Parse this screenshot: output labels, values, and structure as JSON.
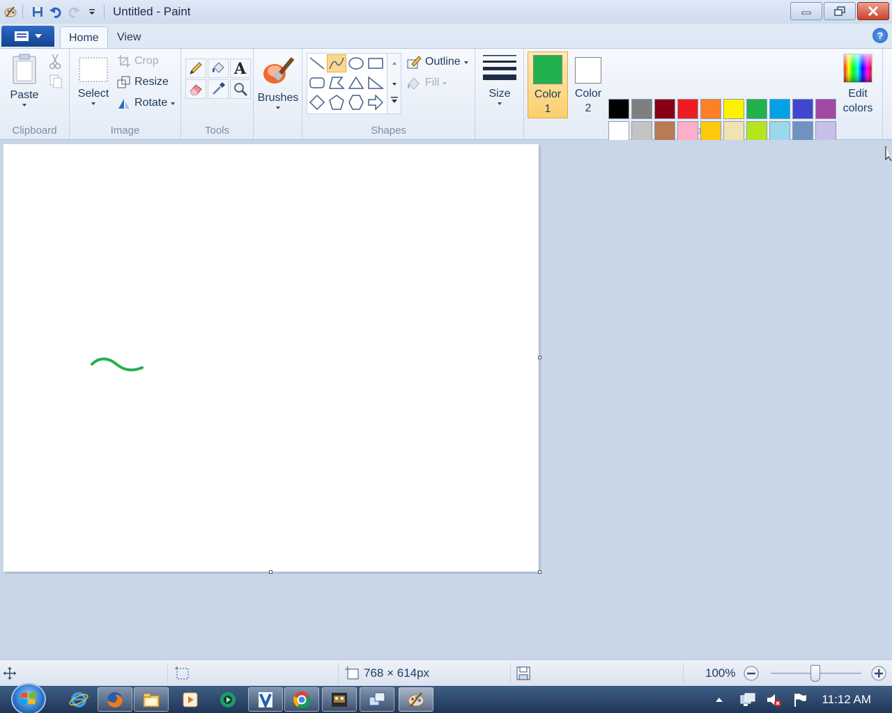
{
  "window": {
    "title": "Untitled - Paint"
  },
  "tabs": {
    "home": "Home",
    "view": "View"
  },
  "clipboard": {
    "paste": "Paste",
    "group": "Clipboard"
  },
  "image": {
    "select": "Select",
    "crop": "Crop",
    "resize": "Resize",
    "rotate": "Rotate",
    "group": "Image"
  },
  "tools": {
    "group": "Tools"
  },
  "brushes": {
    "label": "Brushes"
  },
  "shapes": {
    "outline": "Outline",
    "fill": "Fill",
    "group": "Shapes"
  },
  "size": {
    "label": "Size"
  },
  "colors": {
    "color1_line1": "Color",
    "color1_line2": "1",
    "color2_line1": "Color",
    "color2_line2": "2",
    "color1_value": "#22b14c",
    "color2_value": "#ffffff",
    "edit_line1": "Edit",
    "edit_line2": "colors",
    "group": "Colors",
    "palette": [
      "#000000",
      "#7f7f7f",
      "#880015",
      "#ed1c24",
      "#ff7f27",
      "#fff200",
      "#22b14c",
      "#00a2e8",
      "#3f48cc",
      "#a349a4",
      "#ffffff",
      "#c3c3c3",
      "#b97a57",
      "#ffaec9",
      "#ffc90e",
      "#efe4b0",
      "#b5e61d",
      "#99d9ea",
      "#7092be",
      "#c8bfe7"
    ]
  },
  "canvas": {
    "stroke_color": "#22b14c"
  },
  "status": {
    "dimensions": "768 × 614px",
    "zoom": "100%",
    "zoom_level": 1.0
  },
  "taskbar": {
    "clock": "11:12 AM"
  }
}
